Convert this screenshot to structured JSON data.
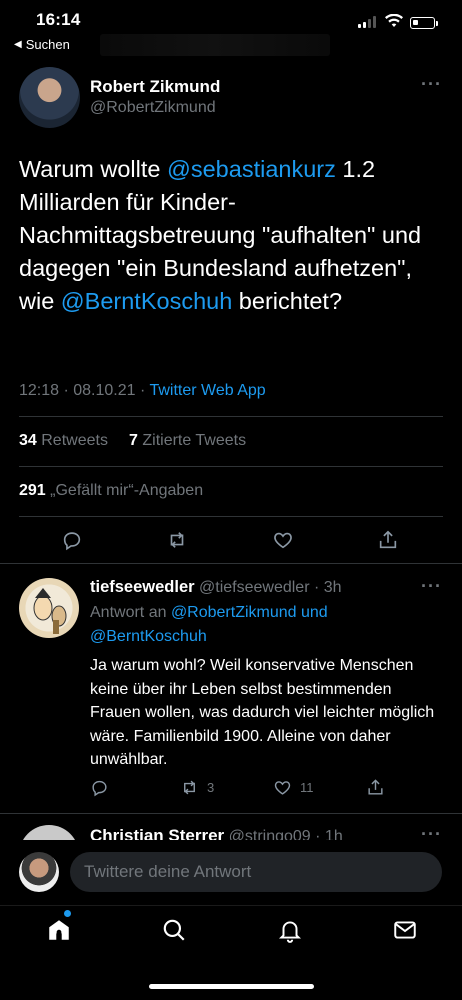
{
  "status_bar": {
    "time": "16:14",
    "back_label": "Suchen"
  },
  "tweet": {
    "author_name": "Robert Zikmund",
    "author_handle": "@RobertZikmund",
    "text_parts": {
      "p1": "Warum wollte ",
      "mention1": "@sebastiankurz",
      "p2": " 1.2 Milliarden für Kinder-Nachmittagsbetreuung \"aufhalten\" und dagegen \"ein Bundesland aufhetzen\", wie ",
      "mention2": "@BerntKoschuh",
      "p3": " berichtet?"
    },
    "time": "12:18 · 08.10.21 · ",
    "source": "Twitter Web App",
    "retweets_count": "34",
    "retweets_label": "Retweets",
    "quotes_count": "7",
    "quotes_label": "Zitierte Tweets",
    "likes_count": "291",
    "likes_label": "„Gefällt mir“-Angaben"
  },
  "reply": {
    "author_name": "tiefseewedler",
    "author_handle": "@tiefseewedler",
    "time": "· 3h",
    "reply_to_prefix": "Antwort an ",
    "reply_to_1": "@RobertZikmund und",
    "reply_to_2": "@BerntKoschuh",
    "text": "Ja warum wohl? Weil konservative Menschen keine über ihr Leben selbst bestimmenden Frauen wollen, was dadurch viel leichter möglich wäre. Familienbild 1900. Alleine von daher unwählbar.",
    "retweets": "3",
    "likes": "11"
  },
  "reply2": {
    "author_name": "Christian Sterrer",
    "author_handle": "@stringo09",
    "time": "· 1h"
  },
  "compose": {
    "placeholder": "Twittere deine Antwort"
  },
  "icons": {
    "more": "more-icon",
    "reply": "reply-icon",
    "retweet": "retweet-icon",
    "like": "like-icon",
    "share": "share-icon",
    "home": "home-icon",
    "search": "search-icon",
    "notifications": "bell-icon",
    "messages": "mail-icon"
  },
  "colors": {
    "background": "#000000",
    "accent": "#1d9bf0",
    "muted": "#71767b",
    "separator": "#2f3336"
  }
}
